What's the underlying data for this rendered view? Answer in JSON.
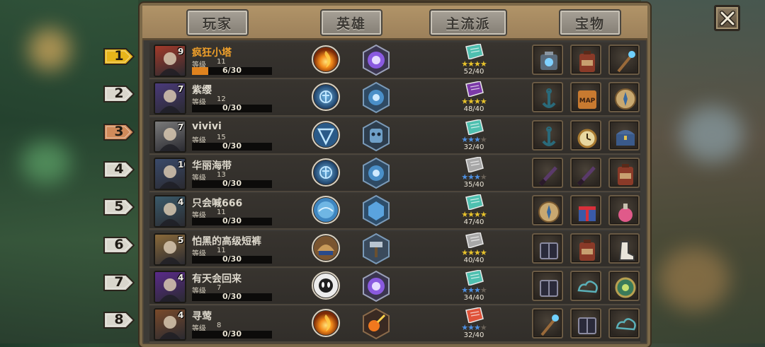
{
  "tabs": [
    {
      "label": "玩家"
    },
    {
      "label": "英雄"
    },
    {
      "label": "主流派"
    },
    {
      "label": "宝物"
    }
  ],
  "level_label": "等级",
  "colors": {
    "gold_name": "#f2a12a",
    "xp_fill": "#e0831e",
    "star_gold": "#e7c22b",
    "star_blue": "#4d8fe0",
    "star_empty": "#6a6258"
  },
  "rows": [
    {
      "rank": "1",
      "avatar_level": "9",
      "name": "疯狂小塔",
      "level": "11",
      "xp": "6/30",
      "xp_fraction": 0.2,
      "hero1": "fire-orb-icon",
      "hero2": "purple-orb-icon",
      "school_color": "#4fc0b0",
      "stars": "★★★★",
      "star_color": "gold",
      "score": "52/40",
      "items": [
        "mech-gem-icon",
        "backpack-icon",
        "magic-staff-icon"
      ]
    },
    {
      "rank": "2",
      "avatar_level": "7",
      "name": "紫缨",
      "level": "12",
      "xp": "0/30",
      "xp_fraction": 0,
      "hero1": "ice-rune-icon",
      "hero2": "ice-rune-hex-icon",
      "school_color": "#7c3aa8",
      "stars": "★★★★",
      "star_color": "gold",
      "score": "48/40",
      "items": [
        "anchor-icon",
        "map-scroll-icon",
        "compass-icon"
      ]
    },
    {
      "rank": "3",
      "avatar_level": "7",
      "name": "vivivi",
      "level": "15",
      "xp": "0/30",
      "xp_fraction": 0,
      "hero1": "ice-shield-icon",
      "hero2": "ice-skull-hex-icon",
      "school_color": "#4fc0b0",
      "stars": "★★★",
      "star_color": "blue",
      "score": "32/40",
      "items": [
        "anchor-icon",
        "pocket-watch-icon",
        "treasure-chest-icon"
      ]
    },
    {
      "rank": "4",
      "avatar_level": "10",
      "name": "华丽海带",
      "level": "13",
      "xp": "0/30",
      "xp_fraction": 0,
      "hero1": "ice-rune-icon",
      "hero2": "ice-rune-hex-icon",
      "school_color": "#a8a8a8",
      "stars": "★★★",
      "star_color": "blue",
      "score": "35/40",
      "items": [
        "dark-blade-icon",
        "dark-blade-icon",
        "backpack-icon"
      ]
    },
    {
      "rank": "5",
      "avatar_level": "4",
      "name": "只会喊666",
      "level": "11",
      "xp": "0/30",
      "xp_fraction": 0,
      "hero1": "water-orb-icon",
      "hero2": "water-hex-icon",
      "school_color": "#4fc0b0",
      "stars": "★★★★",
      "star_color": "gold",
      "score": "47/40",
      "items": [
        "compass-icon",
        "gift-box-icon",
        "potion-icon"
      ]
    },
    {
      "rank": "6",
      "avatar_level": "5",
      "name": "怕黑的高级短裤",
      "level": "11",
      "xp": "0/30",
      "xp_fraction": 0,
      "hero1": "shell-orb-icon",
      "hero2": "hammer-hex-icon",
      "school_color": "#a8a8a8",
      "stars": "★★★★",
      "star_color": "gold",
      "score": "40/40",
      "items": [
        "spell-book-icon",
        "backpack-icon",
        "boots-icon"
      ]
    },
    {
      "rank": "7",
      "avatar_level": "4",
      "name": "有天会回来",
      "level": "7",
      "xp": "0/30",
      "xp_fraction": 0,
      "hero1": "ghost-orb-icon",
      "hero2": "purple-orb-icon",
      "school_color": "#4fc0b0",
      "stars": "★★★",
      "star_color": "blue",
      "score": "34/40",
      "items": [
        "spell-book-icon",
        "cloud-rune-icon",
        "green-coin-icon"
      ]
    },
    {
      "rank": "8",
      "avatar_level": "4",
      "name": "寻莺",
      "level": "8",
      "xp": "0/30",
      "xp_fraction": 0,
      "hero1": "fire-orb-icon",
      "hero2": "meteor-hex-icon",
      "school_color": "#e0533a",
      "stars": "★★★",
      "star_color": "blue",
      "score": "32/40",
      "items": [
        "magic-staff-icon",
        "spell-book-icon",
        "cloud-rune-icon"
      ]
    }
  ]
}
